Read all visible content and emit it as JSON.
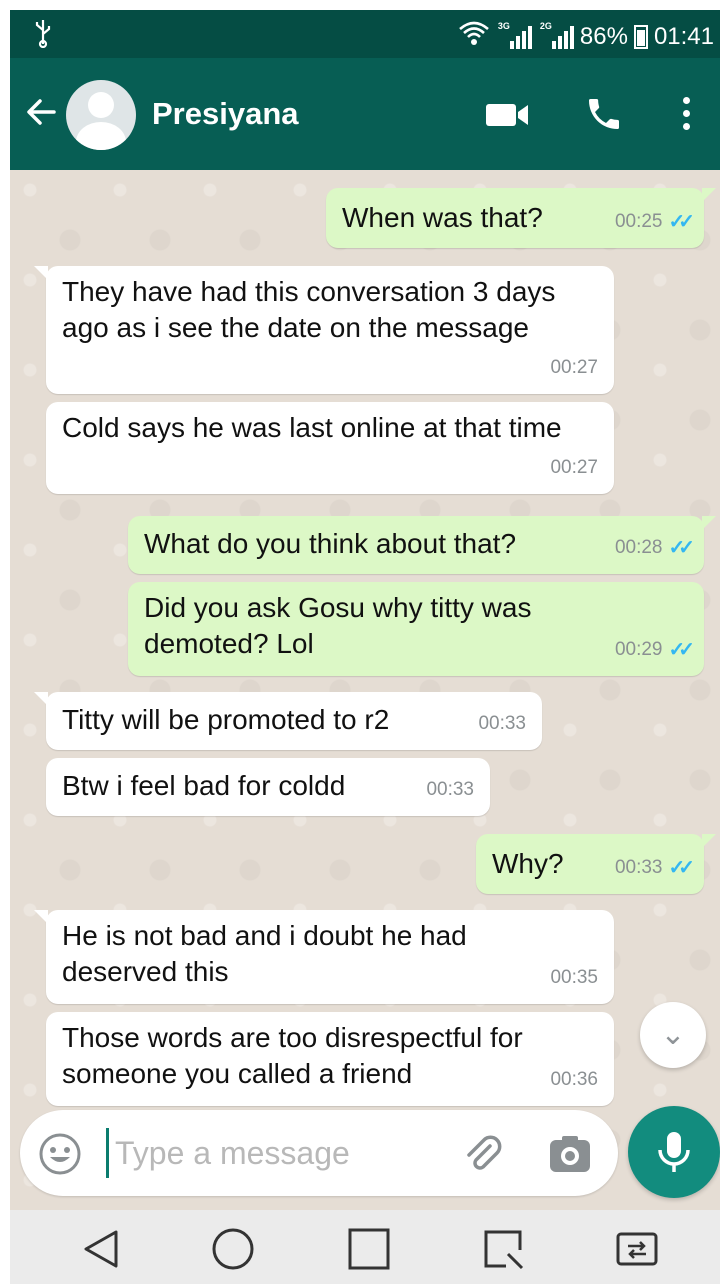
{
  "status_bar": {
    "network_type_1": "3G",
    "network_type_2": "2G",
    "battery_percent": "86%",
    "time": "01:41"
  },
  "header": {
    "contact_name": "Presiyana",
    "colors": {
      "primary_dark": "#054d44",
      "primary": "#075e54"
    },
    "icons": [
      "back-arrow-icon",
      "avatar",
      "video-call-icon",
      "phone-icon",
      "more-vert-icon"
    ]
  },
  "messages": [
    {
      "direction": "out",
      "text": "When was that?",
      "time": "00:25",
      "read": true
    },
    {
      "direction": "in",
      "text": "They have had this conversation 3 days ago as i see the date on the message",
      "time": "00:27"
    },
    {
      "direction": "in",
      "text": "Cold says he was last online at that time",
      "time": "00:27"
    },
    {
      "direction": "out",
      "text": "What do you think about that?",
      "time": "00:28",
      "read": true
    },
    {
      "direction": "out",
      "text": "Did you ask Gosu why titty was demoted? Lol",
      "time": "00:29",
      "read": true
    },
    {
      "direction": "in",
      "text": "Titty will be promoted to r2",
      "time": "00:33"
    },
    {
      "direction": "in",
      "text": "Btw i feel bad for coldd",
      "time": "00:33"
    },
    {
      "direction": "out",
      "text": "Why?",
      "time": "00:33",
      "read": true
    },
    {
      "direction": "in",
      "text": "He is not bad and i doubt he had deserved this",
      "time": "00:35"
    },
    {
      "direction": "in",
      "text": "Those words are too disrespectful for someone you called a friend",
      "time": "00:36"
    }
  ],
  "read_ticks": "✓✓",
  "composer": {
    "placeholder": "Type a message",
    "value": "",
    "icons": [
      "emoji-icon",
      "attach-icon",
      "camera-icon",
      "mic-icon"
    ]
  },
  "scroll_down_glyph": "⌄",
  "nav_bar": {
    "icons": [
      "back-triangle-icon",
      "home-circle-icon",
      "recents-square-icon",
      "screen-capture-icon",
      "dual-window-icon"
    ]
  },
  "colors": {
    "incoming_bubble": "#ffffff",
    "outgoing_bubble": "#dcf8c6",
    "read_tick": "#34b7f1",
    "chat_background": "#e5ddd4",
    "mic_button": "#128c7e"
  }
}
